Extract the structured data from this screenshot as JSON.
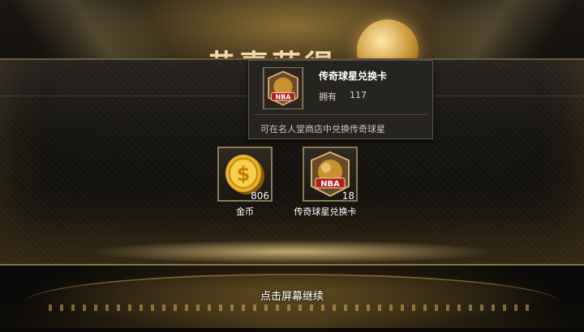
{
  "header": {
    "title": "恭喜获得"
  },
  "tooltip": {
    "item_name": "传奇球星兑换卡",
    "own_label": "拥有",
    "own_value": "117",
    "description": "可在名人堂商店中兑换传奇球星",
    "badge_text": "NBA"
  },
  "rewards": [
    {
      "label": "金币",
      "quantity": "806",
      "icon": "gold-coin-icon"
    },
    {
      "label": "传奇球星兑换卡",
      "quantity": "18",
      "icon": "nba-legend-card-icon",
      "badge_text": "NBA"
    }
  ],
  "footer": {
    "continue_text": "点击屏幕继续"
  },
  "colors": {
    "accent_gold": "#c89a45",
    "frame": "#8d7a53",
    "badge_red": "#b01e1e"
  }
}
